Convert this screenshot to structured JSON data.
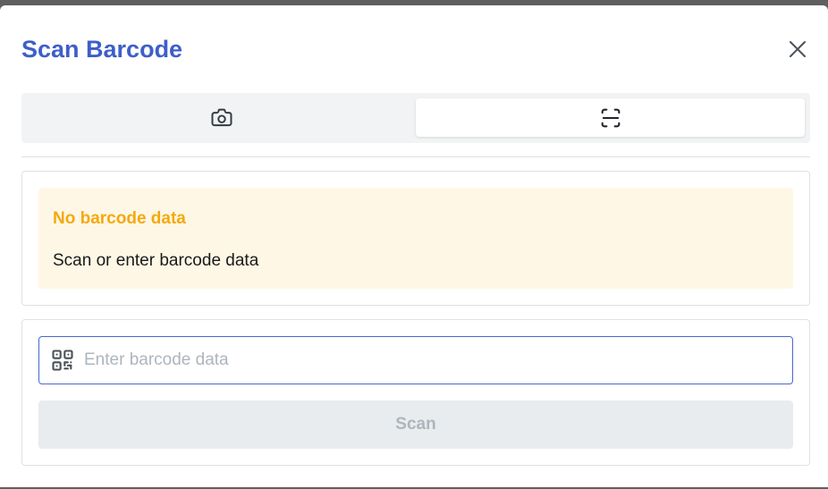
{
  "modal": {
    "title": "Scan Barcode",
    "close_icon": "close-icon"
  },
  "tabs": [
    {
      "icon": "camera-icon",
      "selected": false
    },
    {
      "icon": "scan-icon",
      "selected": true
    }
  ],
  "alert": {
    "title": "No barcode data",
    "message": "Scan or enter barcode data",
    "color": "#f5a90b",
    "background": "#fff7e6"
  },
  "input": {
    "icon": "qr-code-icon",
    "value": "",
    "placeholder": "Enter barcode data"
  },
  "scan_button": {
    "label": "Scan",
    "disabled": true
  },
  "colors": {
    "accent": "#3e5ec9",
    "input_border": "#4a67cf"
  }
}
